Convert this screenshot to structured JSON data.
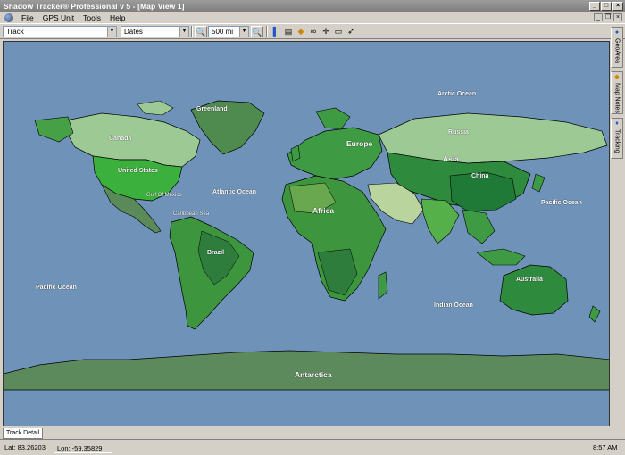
{
  "window": {
    "title": "Shadow Tracker® Professional v 5 - [Map View 1]"
  },
  "menu": {
    "items": [
      "File",
      "GPS Unit",
      "Tools",
      "Help"
    ]
  },
  "toolbar": {
    "track_value": "Track",
    "dates_value": "Dates",
    "scale_value": "500 mi"
  },
  "map": {
    "labels": {
      "greenland": "Greenland",
      "arctic": "Arctic Ocean",
      "canada": "Canada",
      "russia": "Russia",
      "europe": "Europe",
      "asia": "Asia",
      "united_states": "United States",
      "china": "China",
      "atlantic": "Atlantic Ocean",
      "gulf": "Gulf Of Mexico",
      "caribbean": "Caribbean Sea",
      "africa": "Africa",
      "pacific_east": "Pacific Ocean",
      "brazil": "Brazil",
      "pacific_west": "Pacific Ocean",
      "australia": "Australia",
      "indian": "Indian Ocean",
      "antarctica": "Antarctica"
    }
  },
  "side_tabs": [
    "GeoArea",
    "Map Notes",
    "Tracking"
  ],
  "bottom_tab": "Track Detail",
  "status": {
    "lat": "Lat: 83.26203",
    "lon": "Lon: -59.35829",
    "time": "8:57 AM"
  }
}
